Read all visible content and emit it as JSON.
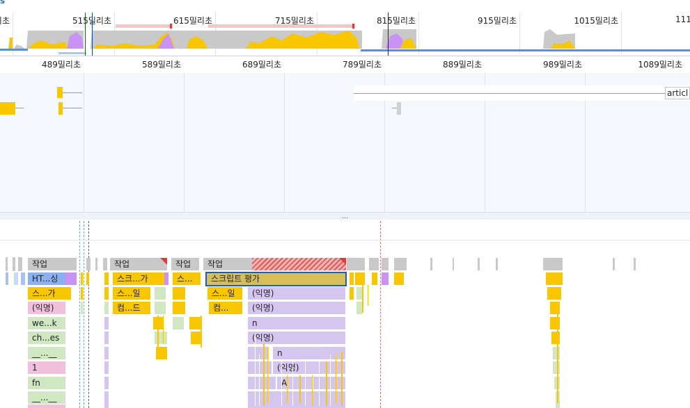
{
  "overview": {
    "corner_glyph": "s",
    "ticks": [
      "리초",
      "515밀리초",
      "615밀리초",
      "715밀리초",
      "815밀리초",
      "915밀리초",
      "1015밀리초",
      "111"
    ]
  },
  "ruler": {
    "ticks": [
      "489밀리초",
      "589밀리초",
      "689밀리초",
      "789밀리초",
      "889밀리초",
      "989밀리초",
      "1089밀리초"
    ]
  },
  "network": {
    "request_label": "articl"
  },
  "splitter": {
    "grip": "···"
  },
  "flame": {
    "task_labels": [
      "작업",
      "작업",
      "작업",
      "작업"
    ],
    "blocks": {
      "html_parse": "HT...싱",
      "script_eval_short_1": "스...가",
      "anon_1": "(익명)",
      "webpack": "we...k",
      "chunks": "ch...es",
      "wrap_1": "__...__",
      "one": "1",
      "fn": "fn",
      "wrap_2": "__...__",
      "script_eval_short_2": "스크...가",
      "script_run_1": "스...일",
      "compile_1": "컴...드",
      "script_eval_short_3": "스...",
      "script_eval_selected": "스크립트 평가",
      "script_run_2": "스...일",
      "compile_2": "컴...",
      "anon_2": "(익명)",
      "anon_3": "(익명)",
      "n_1": "n",
      "anon_4": "(익명)",
      "n_2": "n",
      "anon_5": "(익명)",
      "A": "A"
    }
  },
  "colors": {
    "scripting": "#f8c700",
    "rendering": "#c993f5",
    "loading": "#6ea1ef",
    "task_gray": "#c9c9c9",
    "anon_purple": "#d5c6f0",
    "green": "#cfe8c2",
    "pink": "#f0c0dc",
    "long_task_red": "#e53935"
  }
}
